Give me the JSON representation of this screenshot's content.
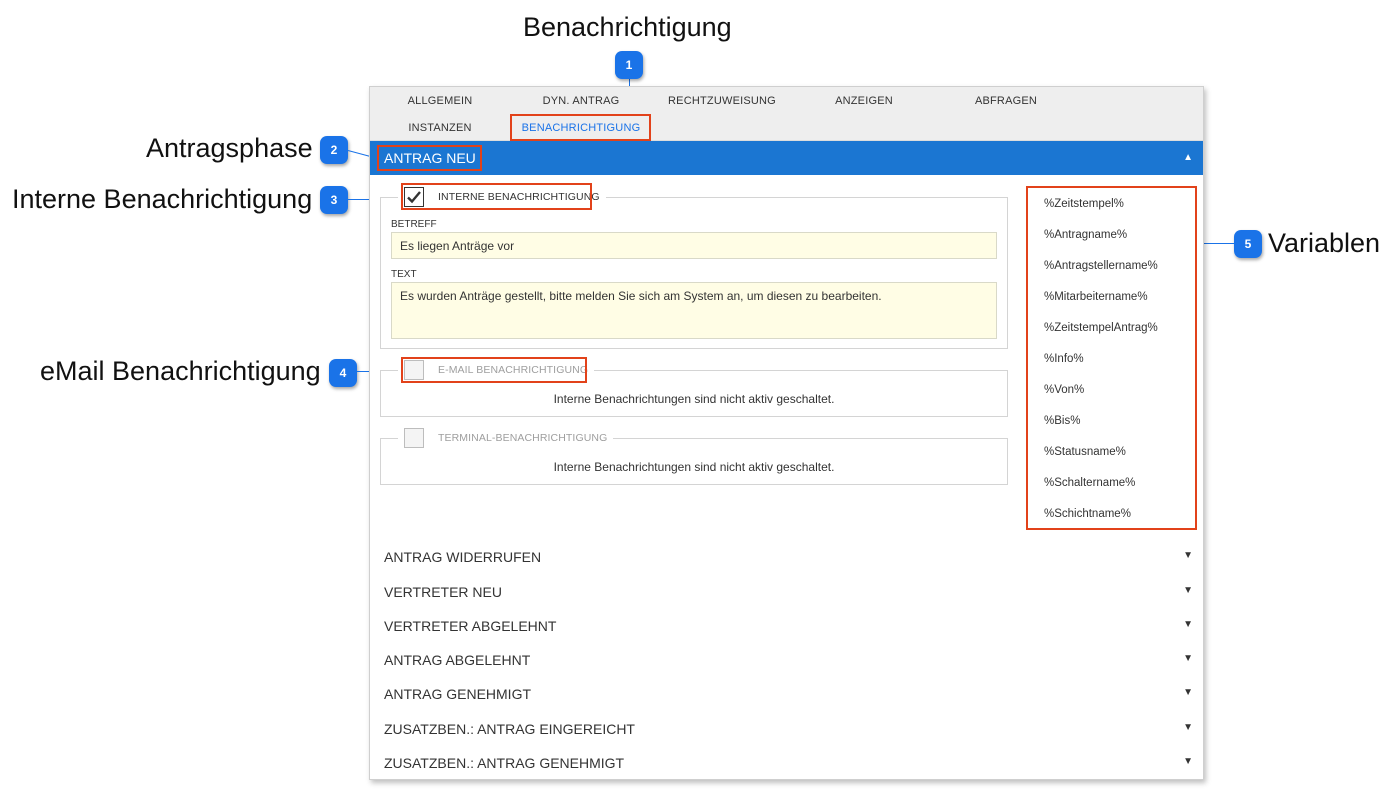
{
  "callouts": {
    "c1": {
      "num": "1",
      "label": "Benachrichtigung"
    },
    "c2": {
      "num": "2",
      "label": "Antragsphase"
    },
    "c3": {
      "num": "3",
      "label": "Interne Benachrichtigung"
    },
    "c4": {
      "num": "4",
      "label": "eMail Benachrichtigung"
    },
    "c5": {
      "num": "5",
      "label": "Variablen"
    }
  },
  "tabs": {
    "row1": [
      "ALLGEMEIN",
      "DYN. ANTRAG",
      "RECHTZUWEISUNG",
      "ANZEIGEN",
      "ABFRAGEN"
    ],
    "row2": [
      "INSTANZEN",
      "BENACHRICHTIGUNG"
    ]
  },
  "phase": {
    "title": "ANTRAG NEU",
    "arrow": "▲"
  },
  "internal": {
    "legend": "INTERNE BENACHRICHTIGUNG",
    "checked": true,
    "subject_label": "BETREFF",
    "subject_value": "Es liegen Anträge vor",
    "text_label": "TEXT",
    "text_value": "Es wurden Anträge gestellt, bitte melden Sie sich am System an, um diesen zu bearbeiten."
  },
  "email": {
    "legend": "E-MAIL BENACHRICHTIGUNG",
    "checked": false,
    "info": "Interne Benachrichtungen sind nicht aktiv geschaltet."
  },
  "terminal": {
    "legend": "TERMINAL-BENACHRICHTIGUNG",
    "checked": false,
    "info": "Interne Benachrichtungen sind nicht aktiv geschaltet."
  },
  "variables": [
    "%Zeitstempel%",
    "%Antragname%",
    "%Antragstellername%",
    "%Mitarbeitername%",
    "%ZeitstempelAntrag%",
    "%Info%",
    "%Von%",
    "%Bis%",
    "%Statusname%",
    "%Schaltername%",
    "%Schichtname%"
  ],
  "accordion": {
    "arrow": "▼",
    "items": [
      "ANTRAG WIDERRUFEN",
      "VERTRETER NEU",
      "VERTRETER ABGELEHNT",
      "ANTRAG ABGELEHNT",
      "ANTRAG GENEHMIGT",
      "ZUSATZBEN.: ANTRAG EINGEREICHT",
      "ZUSATZBEN.: ANTRAG GENEHMIGT"
    ]
  },
  "colors": {
    "accent": "#1b76d2",
    "highlight": "#e2421a",
    "badge": "#1a73e8",
    "input_bg": "#fffde5"
  }
}
